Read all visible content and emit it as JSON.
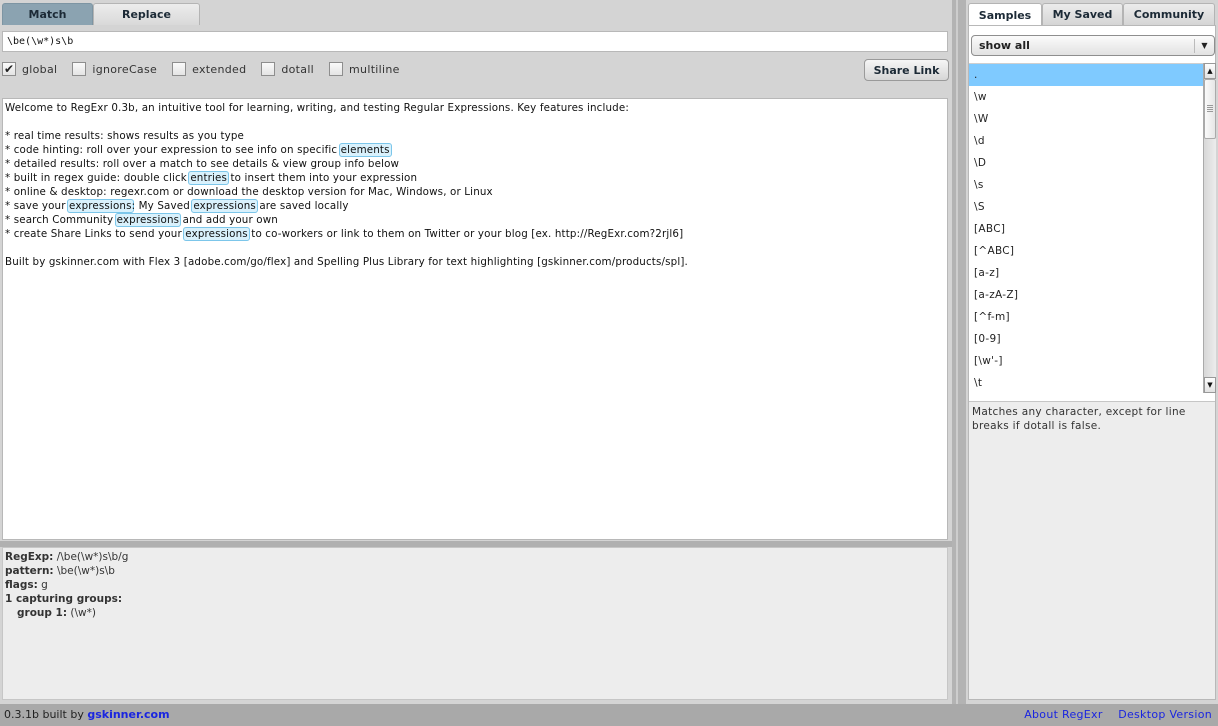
{
  "mode_tabs": [
    {
      "label": "Match",
      "active": true
    },
    {
      "label": "Replace",
      "active": false
    }
  ],
  "pattern": {
    "value": "\\be(\\w*)s\\b"
  },
  "flags": [
    {
      "label": "global",
      "checked": true,
      "check_glyph": "✔"
    },
    {
      "label": "ignoreCase",
      "checked": false,
      "check_glyph": ""
    },
    {
      "label": "extended",
      "checked": false,
      "check_glyph": ""
    },
    {
      "label": "dotall",
      "checked": false,
      "check_glyph": ""
    },
    {
      "label": "multiline",
      "checked": false,
      "check_glyph": ""
    }
  ],
  "share_button": "Share Link",
  "source_text": {
    "lines": [
      [
        {
          "t": "Welcome to RegExr 0.3b, an intuitive tool for learning, writing, and testing Regular Expressions. Key features include:"
        }
      ],
      [
        {
          "t": ""
        }
      ],
      [
        {
          "t": "* real time results: shows results as you type"
        }
      ],
      [
        {
          "t": "* code hinting: roll over your expression to see info on specific "
        },
        {
          "t": "elements",
          "m": true
        }
      ],
      [
        {
          "t": "* detailed results: roll over a match to see details & view group info below"
        }
      ],
      [
        {
          "t": "* built in regex guide: double click "
        },
        {
          "t": "entries",
          "m": true
        },
        {
          "t": " to insert them into your expression"
        }
      ],
      [
        {
          "t": "* online & desktop: regexr.com or download the desktop version for Mac, Windows, or Linux"
        }
      ],
      [
        {
          "t": "* save your "
        },
        {
          "t": "expressions",
          "m": true
        },
        {
          "t": ": My Saved "
        },
        {
          "t": "expressions",
          "m": true
        },
        {
          "t": " are saved locally"
        }
      ],
      [
        {
          "t": "* search Community "
        },
        {
          "t": "expressions",
          "m": true
        },
        {
          "t": " and add your own"
        }
      ],
      [
        {
          "t": "* create Share Links to send your "
        },
        {
          "t": "expressions",
          "m": true
        },
        {
          "t": " to co-workers or link to them on Twitter or your blog [ex. http://RegExr.com?2rjl6]"
        }
      ],
      [
        {
          "t": ""
        }
      ],
      [
        {
          "t": "Built by gskinner.com with Flex 3 [adobe.com/go/flex] and Spelling Plus Library for text highlighting [gskinner.com/products/spl]."
        }
      ]
    ]
  },
  "details": {
    "regexp_label": "RegExp:",
    "regexp_value": " /\\be(\\w*)s\\b/g",
    "pattern_label": "pattern:",
    "pattern_value": " \\be(\\w*)s\\b",
    "flags_label": "flags:",
    "flags_value": " g",
    "groups_label": "1 capturing groups:",
    "group1_label": "group 1:",
    "group1_value": " (\\w*)"
  },
  "library": {
    "tabs": [
      {
        "label": "Samples",
        "active": true
      },
      {
        "label": "My Saved",
        "active": false
      },
      {
        "label": "Community",
        "active": false
      }
    ],
    "filter": "show all",
    "items": [
      ".",
      "\\w",
      "\\W",
      "\\d",
      "\\D",
      "\\s",
      "\\S",
      "[ABC]",
      "[^ABC]",
      "[a-z]",
      "[a-zA-Z]",
      "[^f-m]",
      "[0-9]",
      "[\\w'-]",
      "\\t"
    ],
    "selected_index": 0,
    "description": "Matches any character, except for line breaks if dotall is false."
  },
  "footer": {
    "version_text": "0.3.1b built by ",
    "author_link": "gskinner.com",
    "about_link": "About RegExr",
    "desktop_link": "Desktop Version"
  },
  "icons": {
    "dropdown_arrow": "▼",
    "scroll_up": "▲",
    "scroll_down": "▼"
  }
}
